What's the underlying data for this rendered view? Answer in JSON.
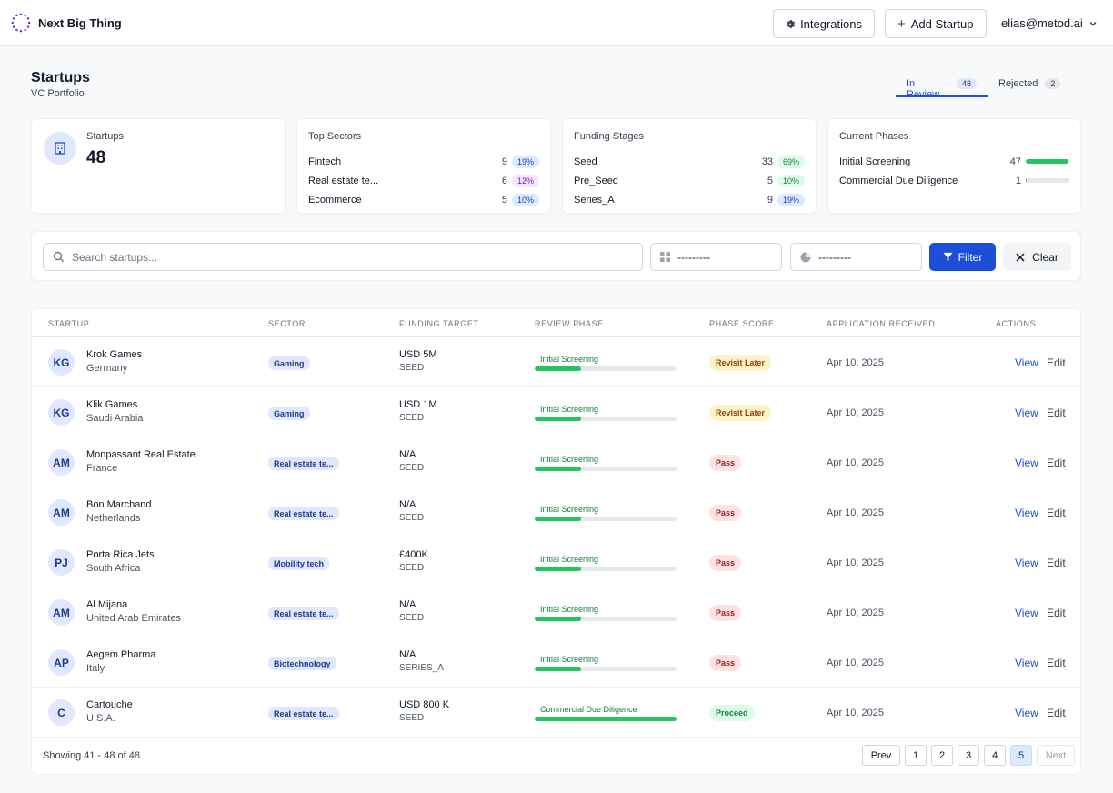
{
  "app": {
    "name": "Next Big Thing"
  },
  "header": {
    "integrations_label": "Integrations",
    "add_label": "Add Startup",
    "user_email": "elias@metod.ai"
  },
  "page": {
    "title": "Startups",
    "subtitle": "VC Portfolio"
  },
  "tabs": [
    {
      "label": "In Review",
      "count": "48"
    },
    {
      "label": "Rejected",
      "count": "2"
    }
  ],
  "stats": {
    "startups": {
      "label": "Startups",
      "value": "48"
    },
    "sectors": {
      "title": "Top Sectors",
      "rows": [
        {
          "name": "Fintech",
          "count": "9",
          "pct": "19%"
        },
        {
          "name": "Real estate te...",
          "count": "6",
          "pct": "12%"
        },
        {
          "name": "Ecommerce",
          "count": "5",
          "pct": "10%"
        }
      ]
    },
    "funding": {
      "title": "Funding Stages",
      "rows": [
        {
          "name": "Seed",
          "count": "33",
          "pct": "69%"
        },
        {
          "name": "Pre_Seed",
          "count": "5",
          "pct": "10%"
        },
        {
          "name": "Series_A",
          "count": "9",
          "pct": "19%"
        }
      ]
    },
    "phases": {
      "title": "Current Phases",
      "rows": [
        {
          "name": "Initial Screening",
          "count": "47",
          "fraction": 0.98
        },
        {
          "name": "Commercial Due Diligence",
          "count": "1",
          "fraction": 0.02
        }
      ]
    }
  },
  "filters": {
    "search_placeholder": "Search startups...",
    "select1_value": "---------",
    "select2_value": "---------",
    "filter_label": "Filter",
    "clear_label": "Clear"
  },
  "table": {
    "columns": [
      "Startup",
      "Sector",
      "Funding Target",
      "Review Phase",
      "Phase Score",
      "Application Received",
      "Actions"
    ],
    "rows": [
      {
        "initials": "KG",
        "name": "Krok Games",
        "country": "Germany",
        "sector": "Gaming",
        "amount": "USD 5M",
        "stage": "SEED",
        "phase": "Initial Screening",
        "phase_progress": 0.33,
        "score": "Revisit Later",
        "received": "Apr 10, 2025"
      },
      {
        "initials": "KG",
        "name": "Klik Games",
        "country": "Saudi Arabia",
        "sector": "Gaming",
        "amount": "USD 1M",
        "stage": "SEED",
        "phase": "Initial Screening",
        "phase_progress": 0.33,
        "score": "Revisit Later",
        "received": "Apr 10, 2025"
      },
      {
        "initials": "AM",
        "name": "Monpassant Real Estate",
        "country": "France",
        "sector": "Real estate te...",
        "amount": "N/A",
        "stage": "SEED",
        "phase": "Initial Screening",
        "phase_progress": 0.33,
        "score": "Pass",
        "received": "Apr 10, 2025"
      },
      {
        "initials": "AM",
        "name": "Bon Marchand",
        "country": "Netherlands",
        "sector": "Real estate te...",
        "amount": "N/A",
        "stage": "SEED",
        "phase": "Initial Screening",
        "phase_progress": 0.33,
        "score": "Pass",
        "received": "Apr 10, 2025"
      },
      {
        "initials": "PJ",
        "name": "Porta Rica Jets",
        "country": "South Africa",
        "sector": "Mobility tech",
        "amount": "£400K",
        "stage": "SEED",
        "phase": "Initial Screening",
        "phase_progress": 0.33,
        "score": "Pass",
        "received": "Apr 10, 2025"
      },
      {
        "initials": "AM",
        "name": "Al Mijana",
        "country": "United Arab Emirates",
        "sector": "Real estate te...",
        "amount": "N/A",
        "stage": "SEED",
        "phase": "Initial Screening",
        "phase_progress": 0.33,
        "score": "Pass",
        "received": "Apr 10, 2025"
      },
      {
        "initials": "AP",
        "name": "Aegem Pharma",
        "country": "Italy",
        "sector": "Biotechnology",
        "amount": "N/A",
        "stage": "SERIES_A",
        "phase": "Initial Screening",
        "phase_progress": 0.33,
        "score": "Pass",
        "received": "Apr 10, 2025"
      },
      {
        "initials": "C",
        "name": "Cartouche",
        "country": "U.S.A.",
        "sector": "Real estate te...",
        "amount": "USD 800 K",
        "stage": "SEED",
        "phase": "Commercial Due Diligence",
        "phase_progress": 1.0,
        "score": "Proceed",
        "received": "Apr 10, 2025"
      }
    ],
    "view_label": "View",
    "edit_label": "Edit"
  },
  "footer": {
    "showing": "Showing 41 - 48 of 48",
    "prev_label": "Prev",
    "next_label": "Next",
    "pages": [
      "1",
      "2",
      "3",
      "4",
      "5"
    ],
    "current_page": "5"
  },
  "colors": {
    "accent": "#1d4ed8",
    "progress": "#22c55e"
  }
}
